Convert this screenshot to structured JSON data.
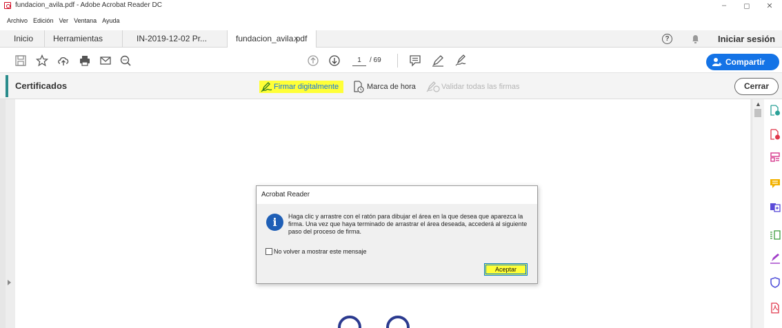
{
  "window": {
    "title": "fundacion_avila.pdf - Adobe Acrobat Reader DC",
    "controls": {
      "minimize": "–",
      "maximize": "◻",
      "close": "✕"
    }
  },
  "menu": [
    "Archivo",
    "Edición",
    "Ver",
    "Ventana",
    "Ayuda"
  ],
  "tabs": {
    "home": "Inicio",
    "tools": "Herramientas",
    "doc1": "IN-2019-12-02 Pr...",
    "doc2": "fundacion_avila.pdf",
    "close_glyph": "×"
  },
  "header": {
    "help_glyph": "?",
    "signin": "Iniciar sesión"
  },
  "toolbar": {
    "page_current": "1",
    "page_total": "/ 69",
    "share_label": "Compartir"
  },
  "certificates": {
    "title": "Certificados",
    "sign_digitally": "Firmar digitalmente",
    "timestamp": "Marca de hora",
    "validate_all": "Validar todas las firmas",
    "close": "Cerrar"
  },
  "dialog": {
    "title": "Acrobat Reader",
    "icon_glyph": "i",
    "message": "Haga clic y arrastre con el ratón para dibujar el área en la que desea que aparezca la firma. Una vez que haya terminado de arrastrar el área deseada, accederá al siguiente paso del proceso de firma.",
    "checkbox_label": "No volver a mostrar este mensaje",
    "button": "Aceptar"
  },
  "colors": {
    "accent_blue": "#1473e6",
    "highlight": "#ffff37",
    "cert_accent": "#2a8c8c"
  },
  "rail_icons": [
    "export-pdf-icon",
    "create-pdf-icon",
    "organize-pages-icon",
    "comment-icon",
    "combine-files-icon",
    "compress-pdf-icon",
    "fill-sign-icon",
    "protect-icon",
    "pdf-icon"
  ]
}
